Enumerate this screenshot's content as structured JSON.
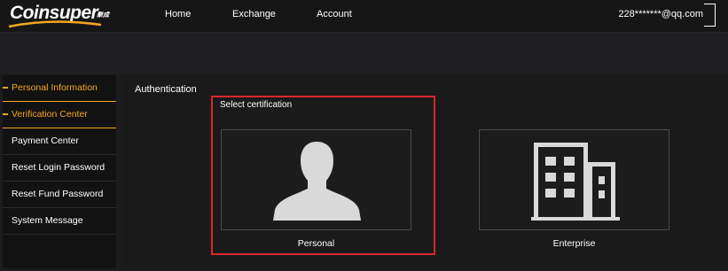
{
  "header": {
    "brand": "Coinsuper",
    "brand_sub": "聚成",
    "nav": [
      "Home",
      "Exchange",
      "Account"
    ],
    "user_email": "228*******@qq.com"
  },
  "sidebar": {
    "items": [
      {
        "label": "Personal Information",
        "active": true
      },
      {
        "label": "Verification Center",
        "active": true
      },
      {
        "label": "Payment Center",
        "active": false
      },
      {
        "label": "Reset Login Password",
        "active": false
      },
      {
        "label": "Reset Fund Password",
        "active": false
      },
      {
        "label": "System Message",
        "active": false
      }
    ]
  },
  "main": {
    "title": "Authentication",
    "select_title": "Select certification",
    "options": [
      {
        "label": "Personal",
        "icon": "person-icon"
      },
      {
        "label": "Enterprise",
        "icon": "building-icon"
      }
    ]
  },
  "colors": {
    "accent": "#f5a623",
    "highlight": "#d9272e",
    "icon": "#d9d9d9",
    "background": "#1c1c1e"
  }
}
